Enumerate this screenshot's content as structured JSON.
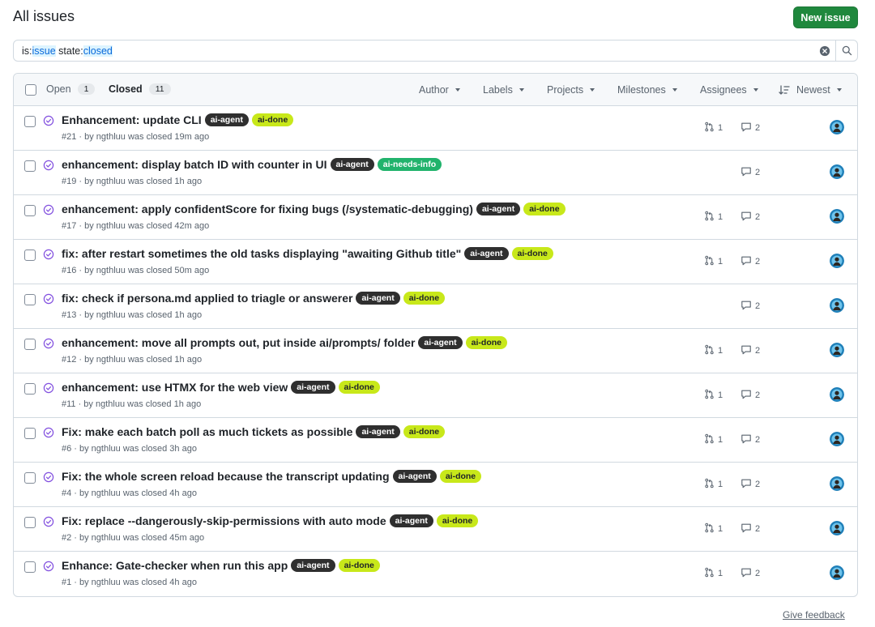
{
  "header": {
    "title": "All issues",
    "new_issue_label": "New issue"
  },
  "search": {
    "prefix1": "is:",
    "value1": "issue",
    "prefix2": " state:",
    "value2": "closed"
  },
  "tabs": {
    "open_label": "Open",
    "open_count": "1",
    "closed_label": "Closed",
    "closed_count": "11"
  },
  "filters": {
    "author": "Author",
    "labels": "Labels",
    "projects": "Projects",
    "milestones": "Milestones",
    "assignees": "Assignees",
    "sort": "Newest"
  },
  "labels": {
    "agent": "ai-agent",
    "done": "ai-done",
    "needs_info": "ai-needs-info"
  },
  "issues": [
    {
      "title": "Enhancement: update CLI",
      "meta": "#21 · by ngthluu was closed 19m ago",
      "labels": [
        "ai-agent",
        "ai-done"
      ],
      "prs": "1",
      "comments": "2"
    },
    {
      "title": "enhancement: display batch ID with counter in UI",
      "meta": "#19 · by ngthluu was closed 1h ago",
      "labels": [
        "ai-agent",
        "ai-needs-info"
      ],
      "prs": "",
      "comments": "2"
    },
    {
      "title": "enhancement: apply confidentScore for fixing bugs (/systematic-debugging)",
      "meta": "#17 · by ngthluu was closed 42m ago",
      "labels": [
        "ai-agent",
        "ai-done"
      ],
      "prs": "1",
      "comments": "2"
    },
    {
      "title": "fix: after restart sometimes the old tasks displaying \"awaiting Github title\"",
      "meta": "#16 · by ngthluu was closed 50m ago",
      "labels": [
        "ai-agent",
        "ai-done"
      ],
      "prs": "1",
      "comments": "2"
    },
    {
      "title": "fix: check if persona.md applied to triagle or answerer",
      "meta": "#13 · by ngthluu was closed 1h ago",
      "labels": [
        "ai-agent",
        "ai-done"
      ],
      "prs": "",
      "comments": "2"
    },
    {
      "title": "enhancement: move all prompts out, put inside ai/prompts/ folder",
      "meta": "#12 · by ngthluu was closed 1h ago",
      "labels": [
        "ai-agent",
        "ai-done"
      ],
      "prs": "1",
      "comments": "2"
    },
    {
      "title": "enhancement: use HTMX for the web view",
      "meta": "#11 · by ngthluu was closed 1h ago",
      "labels": [
        "ai-agent",
        "ai-done"
      ],
      "prs": "1",
      "comments": "2"
    },
    {
      "title": "Fix: make each batch poll as much tickets as possible",
      "meta": "#6 · by ngthluu was closed 3h ago",
      "labels": [
        "ai-agent",
        "ai-done"
      ],
      "prs": "1",
      "comments": "2"
    },
    {
      "title": "Fix: the whole screen reload because the transcript updating",
      "meta": "#4 · by ngthluu was closed 4h ago",
      "labels": [
        "ai-agent",
        "ai-done"
      ],
      "prs": "1",
      "comments": "2"
    },
    {
      "title": "Fix: replace --dangerously-skip-permissions with auto mode",
      "meta": "#2 · by ngthluu was closed 45m ago",
      "labels": [
        "ai-agent",
        "ai-done"
      ],
      "prs": "1",
      "comments": "2"
    },
    {
      "title": "Enhance: Gate-checker when run this app",
      "meta": "#1 · by ngthluu was closed 4h ago",
      "labels": [
        "ai-agent",
        "ai-done"
      ],
      "prs": "1",
      "comments": "2"
    }
  ],
  "footer": {
    "feedback": "Give feedback"
  },
  "colors": {
    "primary_button": "#1f883d",
    "closed_icon": "#8250df",
    "label_agent": "#2f2f2f",
    "label_done": "#c8e81a",
    "label_needs_info": "#21b36c",
    "link": "#0969da"
  },
  "icons": {
    "state": "issue-closed-icon",
    "pr": "git-pull-request-icon",
    "comment": "comment-icon",
    "search": "search-icon",
    "clear": "x-circle-fill-icon",
    "sort": "sort-desc-icon"
  }
}
